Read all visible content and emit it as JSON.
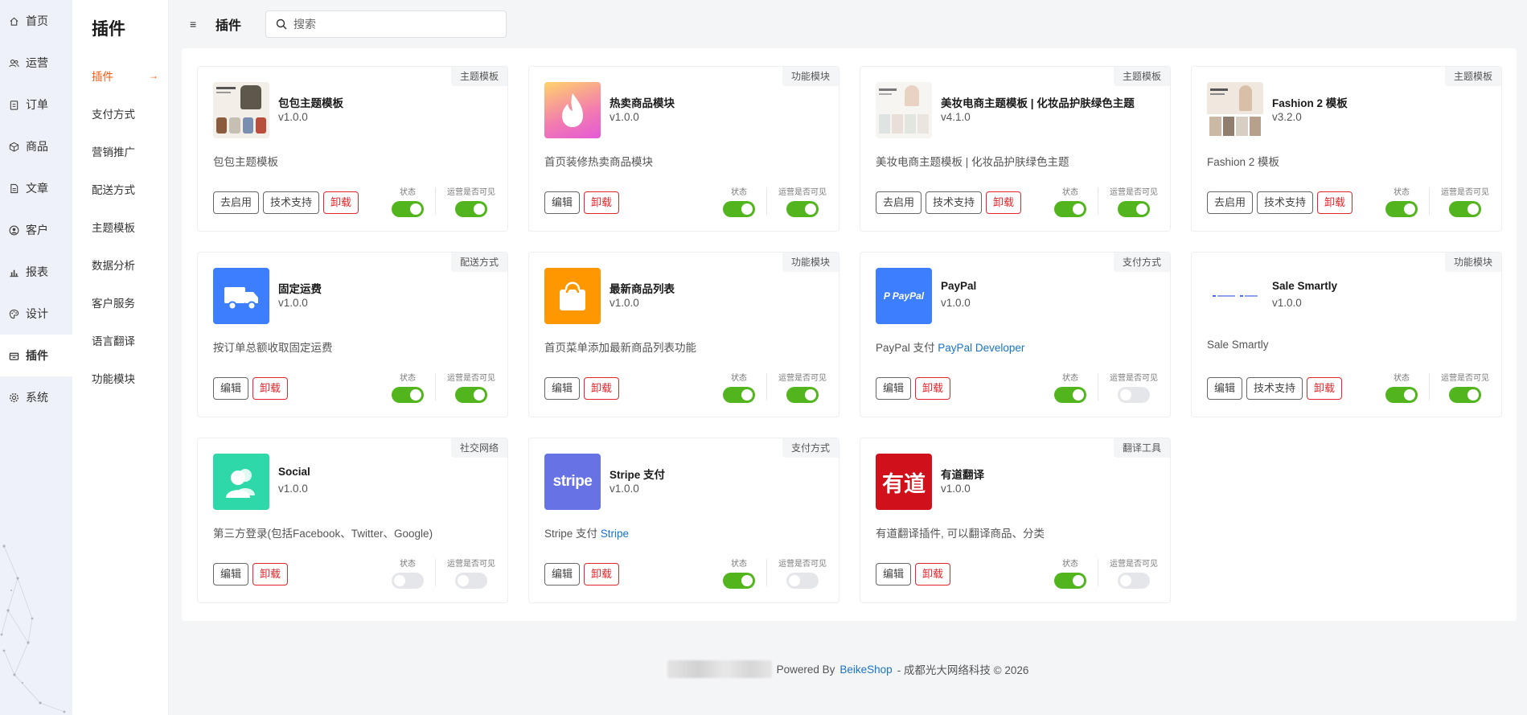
{
  "rail": {
    "items": [
      {
        "label": "首页",
        "icon": "home-icon"
      },
      {
        "label": "运营",
        "icon": "users-icon"
      },
      {
        "label": "订单",
        "icon": "clipboard-icon"
      },
      {
        "label": "商品",
        "icon": "box-icon"
      },
      {
        "label": "文章",
        "icon": "document-icon"
      },
      {
        "label": "客户",
        "icon": "user-circle-icon"
      },
      {
        "label": "报表",
        "icon": "bar-chart-icon"
      },
      {
        "label": "设计",
        "icon": "palette-icon"
      },
      {
        "label": "插件",
        "icon": "plugin-icon",
        "active": true
      },
      {
        "label": "系统",
        "icon": "gear-icon"
      }
    ]
  },
  "subnav": {
    "title": "插件",
    "items": [
      "插件",
      "支付方式",
      "营销推广",
      "配送方式",
      "主题模板",
      "数据分析",
      "客户服务",
      "语言翻译",
      "功能模块"
    ],
    "active_index": 0
  },
  "header": {
    "title": "插件",
    "search_placeholder": "搜索"
  },
  "labels": {
    "status": "状态",
    "visible": "运营是否可见"
  },
  "plugins": [
    {
      "name": "包包主题模板",
      "version": "v1.0.0",
      "tag": "主题模板",
      "desc": "包包主题模板",
      "desc_link": "",
      "buttons": [
        {
          "label": "去启用",
          "type": "normal"
        },
        {
          "label": "技术支持",
          "type": "normal"
        },
        {
          "label": "卸载",
          "type": "danger"
        }
      ],
      "status": true,
      "visible": true,
      "thumb": "bag-theme"
    },
    {
      "name": "热卖商品模块",
      "version": "v1.0.0",
      "tag": "功能模块",
      "desc": "首页装修热卖商品模块",
      "desc_link": "",
      "buttons": [
        {
          "label": "编辑",
          "type": "normal"
        },
        {
          "label": "卸载",
          "type": "danger"
        }
      ],
      "status": true,
      "visible": true,
      "thumb": "flame"
    },
    {
      "name": "美妆电商主题模板 | 化妆品护肤绿色主题",
      "version": "v4.1.0",
      "tag": "主题模板",
      "desc": "美妆电商主题模板 | 化妆品护肤绿色主题",
      "desc_link": "",
      "buttons": [
        {
          "label": "去启用",
          "type": "normal"
        },
        {
          "label": "技术支持",
          "type": "normal"
        },
        {
          "label": "卸载",
          "type": "danger"
        }
      ],
      "status": true,
      "visible": true,
      "thumb": "beauty-theme"
    },
    {
      "name": "Fashion 2 模板",
      "version": "v3.2.0",
      "tag": "主题模板",
      "desc": "Fashion 2 模板",
      "desc_link": "",
      "buttons": [
        {
          "label": "去启用",
          "type": "normal"
        },
        {
          "label": "技术支持",
          "type": "normal"
        },
        {
          "label": "卸载",
          "type": "danger"
        }
      ],
      "status": true,
      "visible": true,
      "thumb": "fashion-theme"
    },
    {
      "name": "固定运费",
      "version": "v1.0.0",
      "tag": "配送方式",
      "desc": "按订单总额收取固定运费",
      "desc_link": "",
      "buttons": [
        {
          "label": "编辑",
          "type": "normal"
        },
        {
          "label": "卸载",
          "type": "danger"
        }
      ],
      "status": true,
      "visible": true,
      "thumb": "truck"
    },
    {
      "name": "最新商品列表",
      "version": "v1.0.0",
      "tag": "功能模块",
      "desc": "首页菜单添加最新商品列表功能",
      "desc_link": "",
      "buttons": [
        {
          "label": "编辑",
          "type": "normal"
        },
        {
          "label": "卸载",
          "type": "danger"
        }
      ],
      "status": true,
      "visible": true,
      "thumb": "shopping-bag"
    },
    {
      "name": "PayPal",
      "version": "v1.0.0",
      "tag": "支付方式",
      "desc": "PayPal 支付",
      "desc_link": "PayPal Developer",
      "buttons": [
        {
          "label": "编辑",
          "type": "normal"
        },
        {
          "label": "卸载",
          "type": "danger"
        }
      ],
      "status": true,
      "visible": false,
      "thumb": "paypal"
    },
    {
      "name": "Sale Smartly",
      "version": "v1.0.0",
      "tag": "功能模块",
      "desc": "Sale Smartly",
      "desc_link": "",
      "buttons": [
        {
          "label": "编辑",
          "type": "normal"
        },
        {
          "label": "技术支持",
          "type": "normal"
        },
        {
          "label": "卸载",
          "type": "danger"
        }
      ],
      "status": true,
      "visible": true,
      "thumb": "salesmartly"
    },
    {
      "name": "Social",
      "version": "v1.0.0",
      "tag": "社交网络",
      "desc": "第三方登录(包括Facebook、Twitter、Google)",
      "desc_link": "",
      "buttons": [
        {
          "label": "编辑",
          "type": "normal"
        },
        {
          "label": "卸载",
          "type": "danger"
        }
      ],
      "status": false,
      "visible": false,
      "thumb": "social"
    },
    {
      "name": "Stripe 支付",
      "version": "v1.0.0",
      "tag": "支付方式",
      "desc": "Stripe 支付",
      "desc_link": "Stripe",
      "buttons": [
        {
          "label": "编辑",
          "type": "normal"
        },
        {
          "label": "卸载",
          "type": "danger"
        }
      ],
      "status": true,
      "visible": false,
      "thumb": "stripe"
    },
    {
      "name": "有道翻译",
      "version": "v1.0.0",
      "tag": "翻译工具",
      "desc": "有道翻译插件, 可以翻译商品、分类",
      "desc_link": "",
      "buttons": [
        {
          "label": "编辑",
          "type": "normal"
        },
        {
          "label": "卸载",
          "type": "danger"
        }
      ],
      "status": true,
      "visible": false,
      "thumb": "youdao"
    }
  ],
  "thumb_text": {
    "paypal": "P PayPal",
    "stripe": "stripe",
    "youdao": "有道"
  },
  "footer": {
    "powered_by": "Powered By",
    "brand": "BeikeShop",
    "company": "-  成都光大网络科技 © 2026"
  },
  "colors": {
    "accent": "#fd560f",
    "switch_on": "#52b51e",
    "danger": "#e0262c",
    "link": "#1a73c8"
  }
}
